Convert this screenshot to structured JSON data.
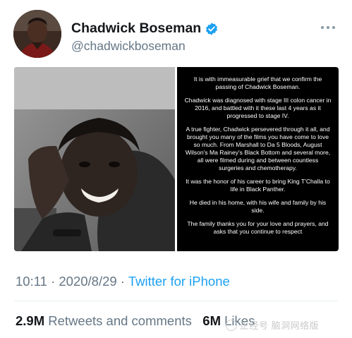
{
  "profile": {
    "display_name": "Chadwick Boseman",
    "handle": "@chadwickboseman",
    "verified": true,
    "verified_color": "#1da1f2"
  },
  "media": {
    "statement": [
      "It is with immeasurable grief that we confirm the passing of Chadwick Boseman.",
      "Chadwick was diagnosed with stage III colon cancer in 2016, and battled with it these last 4 years as it progressed to stage IV.",
      "A true fighter, Chadwick persevered through it all, and brought you many of the films you have come to love so much. From Marshall to Da 5 Bloods, August Wilson's Ma Rainey's Black Bottom and several more, all were filmed during and between countless surgeries and chemotherapy.",
      "It was the honor of his career to bring King T'Challa to life in Black Panther.",
      "He died in his home, with his wife and family by his side.",
      "The family thanks you for your love and prayers, and asks that you continue to respect"
    ]
  },
  "tweet": {
    "time": "10:11",
    "separator": "·",
    "date": "2020/8/29",
    "source": "Twitter for iPhone"
  },
  "stats": {
    "retweets_count": "2.9M",
    "retweets_label": "Retweets and comments",
    "likes_count": "6M",
    "likes_label": "Likes"
  },
  "watermark": {
    "text": "正经号 脑洞网络版"
  },
  "icons": {
    "verified": "verified-badge-icon",
    "more": "more-options-icon"
  }
}
